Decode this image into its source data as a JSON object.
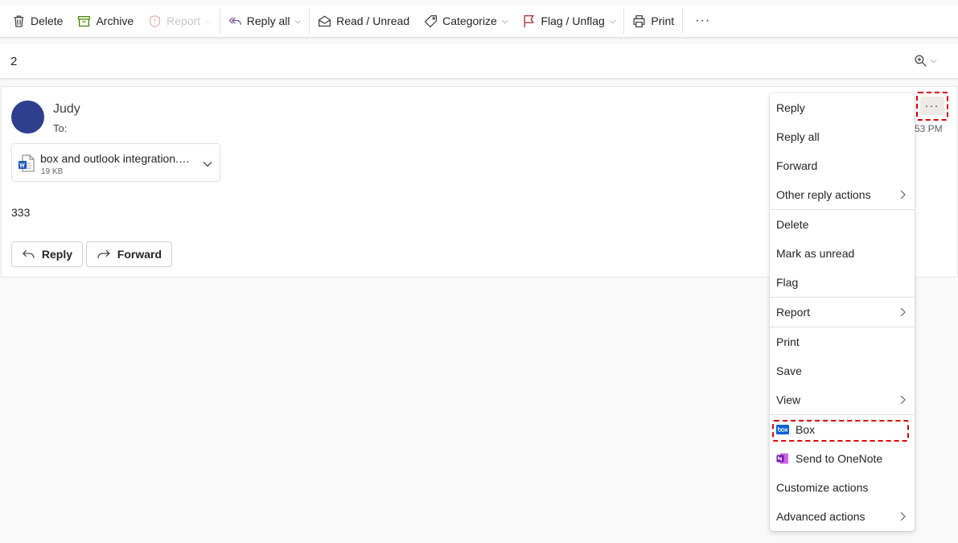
{
  "toolbar": {
    "delete_label": "Delete",
    "archive_label": "Archive",
    "report_label": "Report",
    "reply_all_label": "Reply all",
    "read_unread_label": "Read / Unread",
    "categorize_label": "Categorize",
    "flag_label": "Flag / Unflag",
    "print_label": "Print",
    "more_label": "···"
  },
  "subject": {
    "text": "2"
  },
  "message": {
    "sender": "Judy",
    "to_label": "To:",
    "time": "53 PM",
    "attachment": {
      "name": "box and outlook integration.docx",
      "size": "19 KB"
    },
    "body": "333",
    "reply_label": "Reply",
    "forward_label": "Forward",
    "more_label": "···"
  },
  "context_menu": {
    "reply": "Reply",
    "reply_all": "Reply all",
    "forward": "Forward",
    "other_reply_actions": "Other reply actions",
    "delete": "Delete",
    "mark_as_unread": "Mark as unread",
    "flag": "Flag",
    "report": "Report",
    "print": "Print",
    "save": "Save",
    "view": "View",
    "box": "Box",
    "send_to_onenote": "Send to OneNote",
    "customize_actions": "Customize actions",
    "advanced_actions": "Advanced actions"
  },
  "icons": {
    "delete": "trash-icon",
    "archive": "archive-icon",
    "report": "shield-icon",
    "reply_all": "reply-all-icon",
    "read_unread": "envelope-open-icon",
    "categorize": "tag-icon",
    "flag": "flag-icon",
    "print": "printer-icon",
    "zoom": "zoom-in-icon",
    "attachment": "word-doc-icon",
    "box": "box-logo-icon",
    "onenote": "onenote-icon"
  },
  "colors": {
    "accent": "#0f6cbd",
    "avatar": "#2f3f8f",
    "highlight": "#d40000",
    "flag": "#a4262c",
    "archive": "#498205",
    "onenote": "#7719aa",
    "box": "#0061d5"
  }
}
